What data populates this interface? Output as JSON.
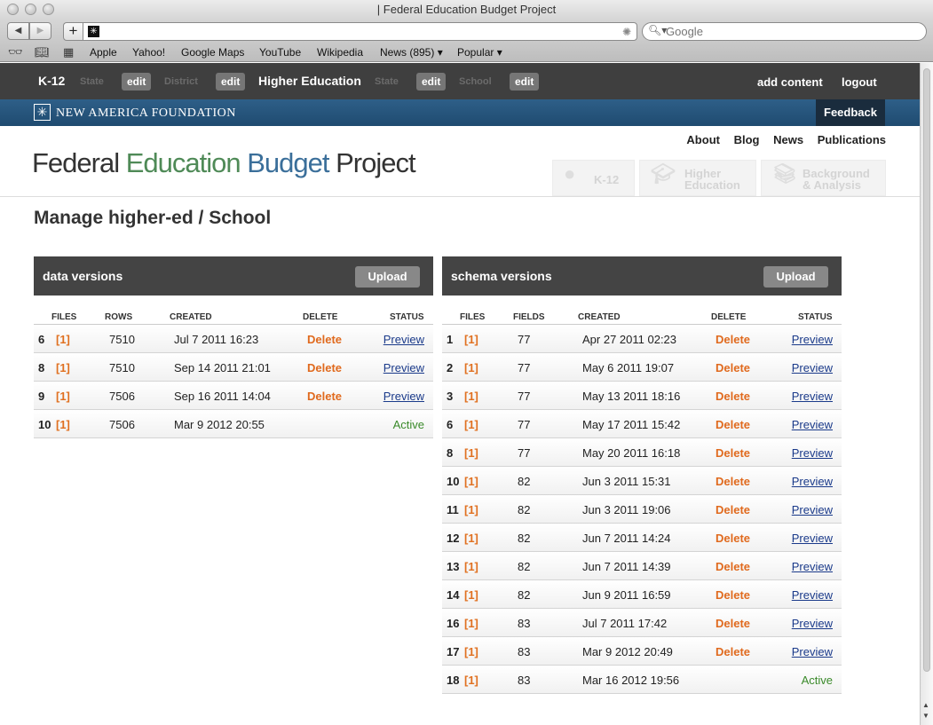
{
  "browser": {
    "window_title": "| Federal Education Budget Project",
    "search_placeholder": "Google",
    "bookmarks": [
      "Apple",
      "Yahoo!",
      "Google Maps",
      "YouTube",
      "Wikipedia",
      "News (895) ▾",
      "Popular ▾"
    ]
  },
  "adminbar": {
    "k12": "K-12",
    "state1": "State",
    "edit": "edit",
    "district": "District",
    "higher_ed": "Higher Education",
    "state2": "State",
    "school": "School",
    "add_content": "add content",
    "logout": "logout"
  },
  "naf": {
    "name": "NEW AMERICA FOUNDATION",
    "feedback": "Feedback"
  },
  "header": {
    "links": [
      "About",
      "Blog",
      "News",
      "Publications"
    ],
    "title_part1": "Federal ",
    "title_part2": "Education ",
    "title_part3": "Budget",
    "title_part4": " Project",
    "tabs": [
      {
        "label": "K-12",
        "icon": "apple-icon"
      },
      {
        "label": "Higher\nEducation",
        "icon": "graduation-cap-icon"
      },
      {
        "label": "Background\n& Analysis",
        "icon": "book-icon"
      }
    ]
  },
  "page_title": "Manage higher-ed / School",
  "data_versions": {
    "title": "data versions",
    "upload": "Upload",
    "columns": [
      "FILES",
      "ROWS",
      "CREATED",
      "DELETE",
      "STATUS"
    ],
    "rows": [
      {
        "id": "6",
        "files": "[1]",
        "count": "7510",
        "created": "Jul 7 2011 16:23",
        "delete": "Delete",
        "status": "Preview"
      },
      {
        "id": "8",
        "files": "[1]",
        "count": "7510",
        "created": "Sep 14 2011 21:01",
        "delete": "Delete",
        "status": "Preview"
      },
      {
        "id": "9",
        "files": "[1]",
        "count": "7506",
        "created": "Sep 16 2011 14:04",
        "delete": "Delete",
        "status": "Preview"
      },
      {
        "id": "10",
        "files": "[1]",
        "count": "7506",
        "created": "Mar 9 2012 20:55",
        "delete": "",
        "status": "Active"
      }
    ]
  },
  "schema_versions": {
    "title": "schema versions",
    "upload": "Upload",
    "columns": [
      "FILES",
      "FIELDS",
      "CREATED",
      "DELETE",
      "STATUS"
    ],
    "rows": [
      {
        "id": "1",
        "files": "[1]",
        "count": "77",
        "created": "Apr 27 2011 02:23",
        "delete": "Delete",
        "status": "Preview"
      },
      {
        "id": "2",
        "files": "[1]",
        "count": "77",
        "created": "May 6 2011 19:07",
        "delete": "Delete",
        "status": "Preview"
      },
      {
        "id": "3",
        "files": "[1]",
        "count": "77",
        "created": "May 13 2011 18:16",
        "delete": "Delete",
        "status": "Preview"
      },
      {
        "id": "6",
        "files": "[1]",
        "count": "77",
        "created": "May 17 2011 15:42",
        "delete": "Delete",
        "status": "Preview"
      },
      {
        "id": "8",
        "files": "[1]",
        "count": "77",
        "created": "May 20 2011 16:18",
        "delete": "Delete",
        "status": "Preview"
      },
      {
        "id": "10",
        "files": "[1]",
        "count": "82",
        "created": "Jun 3 2011 15:31",
        "delete": "Delete",
        "status": "Preview"
      },
      {
        "id": "11",
        "files": "[1]",
        "count": "82",
        "created": "Jun 3 2011 19:06",
        "delete": "Delete",
        "status": "Preview"
      },
      {
        "id": "12",
        "files": "[1]",
        "count": "82",
        "created": "Jun 7 2011 14:24",
        "delete": "Delete",
        "status": "Preview"
      },
      {
        "id": "13",
        "files": "[1]",
        "count": "82",
        "created": "Jun 7 2011 14:39",
        "delete": "Delete",
        "status": "Preview"
      },
      {
        "id": "14",
        "files": "[1]",
        "count": "82",
        "created": "Jun 9 2011 16:59",
        "delete": "Delete",
        "status": "Preview"
      },
      {
        "id": "16",
        "files": "[1]",
        "count": "83",
        "created": "Jul 7 2011 17:42",
        "delete": "Delete",
        "status": "Preview"
      },
      {
        "id": "17",
        "files": "[1]",
        "count": "83",
        "created": "Mar 9 2012 20:49",
        "delete": "Delete",
        "status": "Preview"
      },
      {
        "id": "18",
        "files": "[1]",
        "count": "83",
        "created": "Mar 16 2012 19:56",
        "delete": "",
        "status": "Active"
      }
    ]
  }
}
